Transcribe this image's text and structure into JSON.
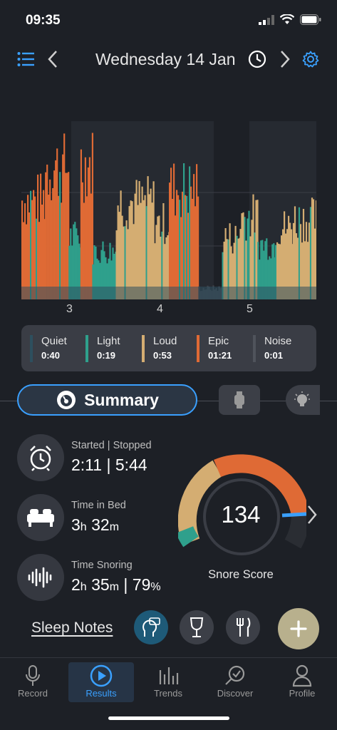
{
  "status_bar": {
    "time": "09:35"
  },
  "header": {
    "date": "Wednesday 14 Jan"
  },
  "chart_data": {
    "type": "area",
    "xlabel": "",
    "ylabel": "",
    "x_ticks": [
      "3",
      "4",
      "5"
    ],
    "series_colors": {
      "quiet": "#2d4f5e",
      "light": "#2fa08c",
      "loud": "#d4ad72",
      "epic": "#df6a35",
      "noise": "#3f434a"
    },
    "segments": [
      {
        "start": 0.0,
        "end": 0.08,
        "level": "epic",
        "height": 0.72
      },
      {
        "start": 0.08,
        "end": 0.16,
        "level": "epic",
        "height": 0.95
      },
      {
        "start": 0.16,
        "end": 0.2,
        "level": "light",
        "height": 0.45
      },
      {
        "start": 0.2,
        "end": 0.24,
        "level": "epic",
        "height": 0.98
      },
      {
        "start": 0.24,
        "end": 0.32,
        "level": "light",
        "height": 0.35
      },
      {
        "start": 0.32,
        "end": 0.45,
        "level": "loud",
        "height": 0.7
      },
      {
        "start": 0.45,
        "end": 0.5,
        "level": "loud",
        "height": 0.55
      },
      {
        "start": 0.5,
        "end": 0.6,
        "level": "epic",
        "height": 0.8
      },
      {
        "start": 0.6,
        "end": 0.68,
        "level": "noise",
        "height": 0.08
      },
      {
        "start": 0.68,
        "end": 0.74,
        "level": "loud",
        "height": 0.45
      },
      {
        "start": 0.74,
        "end": 0.8,
        "level": "loud",
        "height": 0.6
      },
      {
        "start": 0.8,
        "end": 0.86,
        "level": "light",
        "height": 0.4
      },
      {
        "start": 0.86,
        "end": 0.92,
        "level": "loud",
        "height": 0.52
      },
      {
        "start": 0.92,
        "end": 1.0,
        "level": "loud",
        "height": 0.58
      }
    ]
  },
  "legend": [
    {
      "label": "Quiet",
      "value": "0:40",
      "color": "#2d4f5e"
    },
    {
      "label": "Light",
      "value": "0:19",
      "color": "#2fa08c"
    },
    {
      "label": "Loud",
      "value": "0:53",
      "color": "#d4ad72"
    },
    {
      "label": "Epic",
      "value": "01:21",
      "color": "#df6a35"
    },
    {
      "label": "Noise",
      "value": "0:01",
      "color": "#4f535b"
    }
  ],
  "tabs": {
    "summary": "Summary"
  },
  "stats": {
    "started": {
      "label": "Started | Stopped",
      "value": "2:11 | 5:44"
    },
    "bed": {
      "label": "Time in Bed",
      "h": "3",
      "h_unit": "h",
      "m": "32",
      "m_unit": "m"
    },
    "snoring": {
      "label": "Time Snoring",
      "h": "2",
      "h_unit": "h",
      "m": "35",
      "m_unit": "m",
      "sep": "|",
      "pct": "79",
      "pct_unit": "%"
    }
  },
  "score": {
    "value": "134",
    "label": "Snore Score"
  },
  "notes": {
    "title": "Sleep Notes"
  },
  "nav": [
    {
      "label": "Record"
    },
    {
      "label": "Results"
    },
    {
      "label": "Trends"
    },
    {
      "label": "Discover"
    },
    {
      "label": "Profile"
    }
  ]
}
